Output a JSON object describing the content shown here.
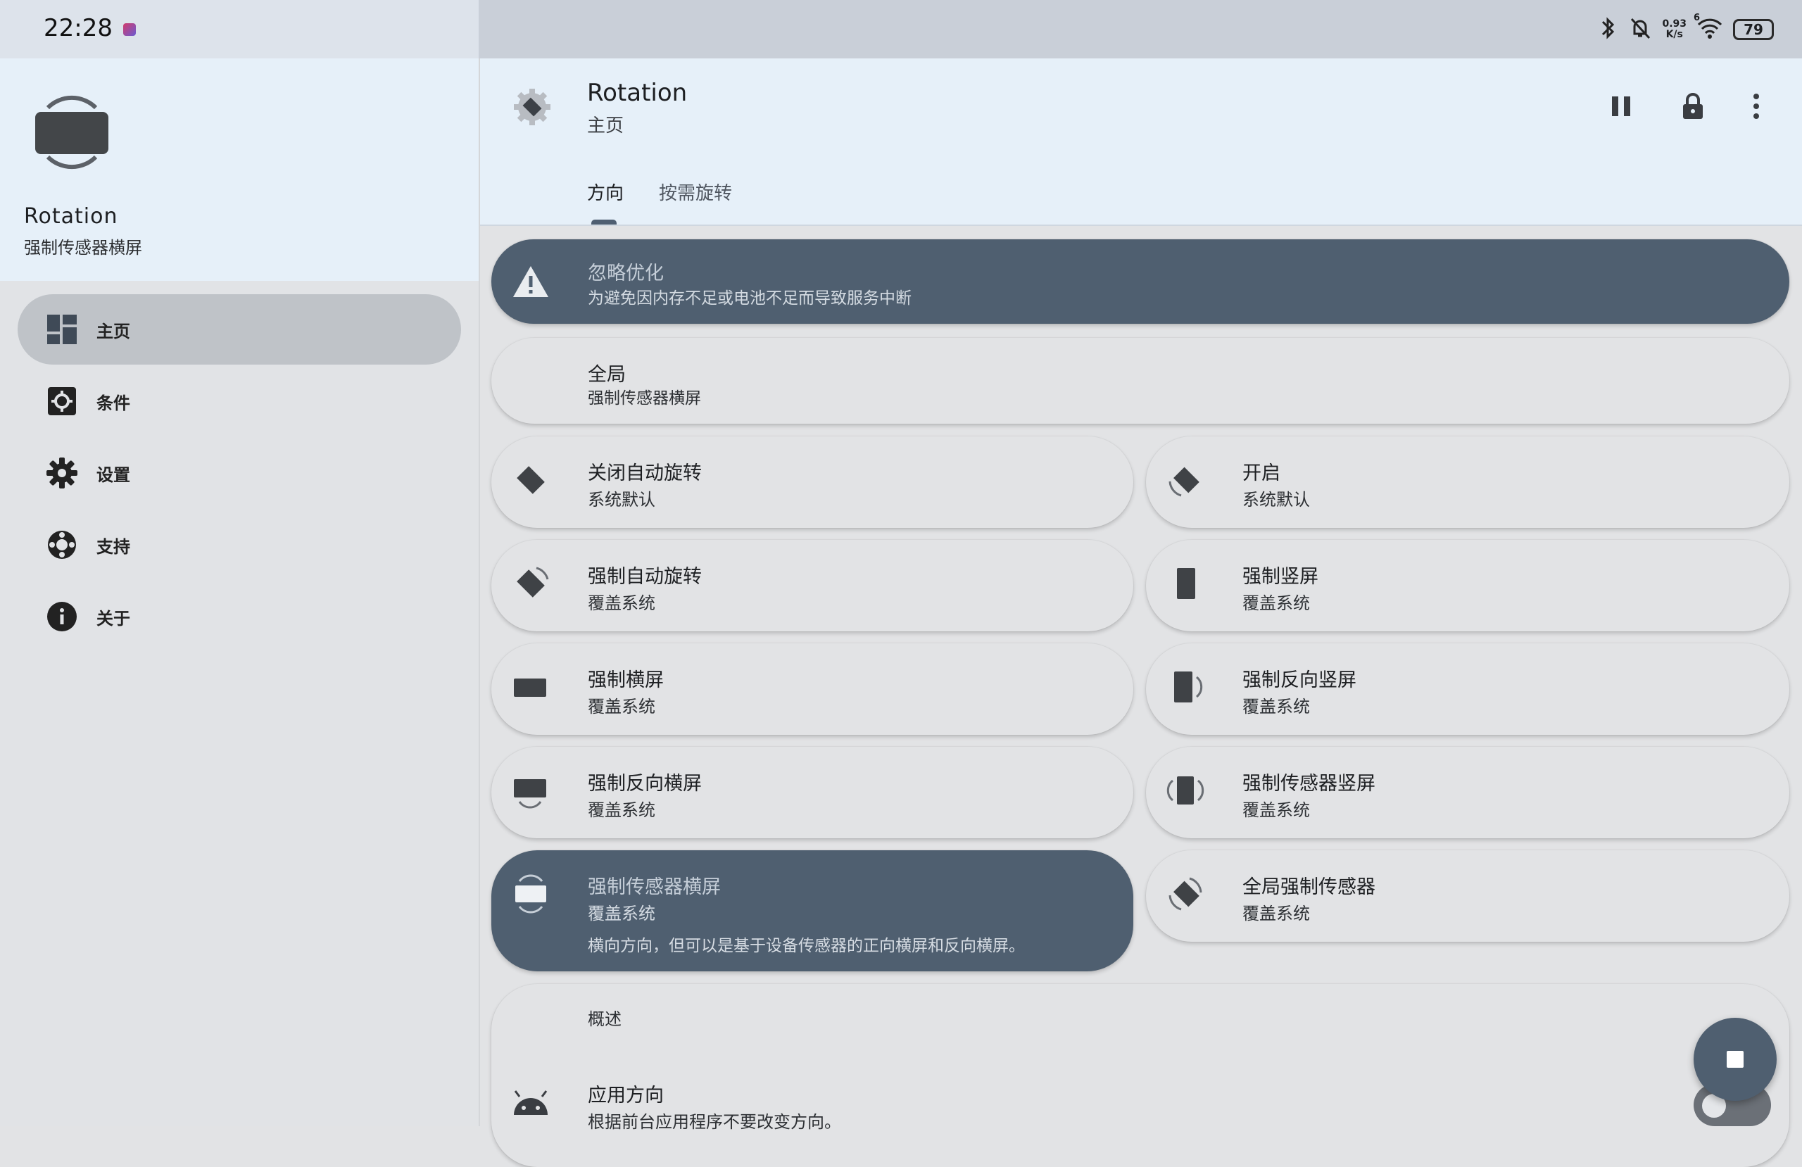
{
  "status_bar": {
    "time": "22:28",
    "net_speed_value": "0.93",
    "net_speed_unit": "K/s",
    "wifi_badge": "6",
    "battery": "79"
  },
  "drawer": {
    "app_name": "Rotation",
    "app_status": "强制传感器横屏",
    "items": [
      {
        "label": "主页",
        "icon": "dashboard-icon",
        "active": true
      },
      {
        "label": "条件",
        "icon": "conditions-icon",
        "active": false
      },
      {
        "label": "设置",
        "icon": "gear-icon",
        "active": false
      },
      {
        "label": "支持",
        "icon": "support-icon",
        "active": false
      },
      {
        "label": "关于",
        "icon": "info-icon",
        "active": false
      }
    ]
  },
  "header": {
    "title": "Rotation",
    "subtitle": "主页",
    "actions": [
      "pause-icon",
      "lock-icon",
      "more-vert-icon"
    ],
    "tabs": [
      {
        "label": "方向",
        "selected": true
      },
      {
        "label": "按需旋转",
        "selected": false
      }
    ]
  },
  "banner": {
    "title": "忽略优化",
    "subtitle": "为避免因内存不足或电池不足而导致服务中断"
  },
  "global": {
    "title": "全局",
    "subtitle": "强制传感器横屏"
  },
  "modes": [
    {
      "title": "关闭自动旋转",
      "subtitle": "系统默认",
      "icon": "rotation-off-icon"
    },
    {
      "title": "开启",
      "subtitle": "系统默认",
      "icon": "rotation-on-icon"
    },
    {
      "title": "强制自动旋转",
      "subtitle": "覆盖系统",
      "icon": "force-auto-rotate-icon"
    },
    {
      "title": "强制竖屏",
      "subtitle": "覆盖系统",
      "icon": "portrait-icon"
    },
    {
      "title": "强制横屏",
      "subtitle": "覆盖系统",
      "icon": "landscape-icon"
    },
    {
      "title": "强制反向竖屏",
      "subtitle": "覆盖系统",
      "icon": "reverse-portrait-icon"
    },
    {
      "title": "强制反向横屏",
      "subtitle": "覆盖系统",
      "icon": "reverse-landscape-icon"
    },
    {
      "title": "强制传感器竖屏",
      "subtitle": "覆盖系统",
      "icon": "sensor-portrait-icon"
    },
    {
      "title": "强制传感器横屏",
      "subtitle": "覆盖系统",
      "description": "横向方向，但可以是基于设备传感器的正向横屏和反向横屏。",
      "icon": "sensor-landscape-icon",
      "selected": true
    },
    {
      "title": "全局强制传感器",
      "subtitle": "覆盖系统",
      "icon": "full-sensor-icon"
    }
  ],
  "overview": {
    "header": "概述",
    "app_orientation_title": "应用方向",
    "app_orientation_sub": "根据前台应用程序不要改变方向。"
  },
  "colors": {
    "accent_dark": "#4f5f70",
    "header_bg": "#e6f0f9",
    "surface": "#e2e3e5"
  }
}
